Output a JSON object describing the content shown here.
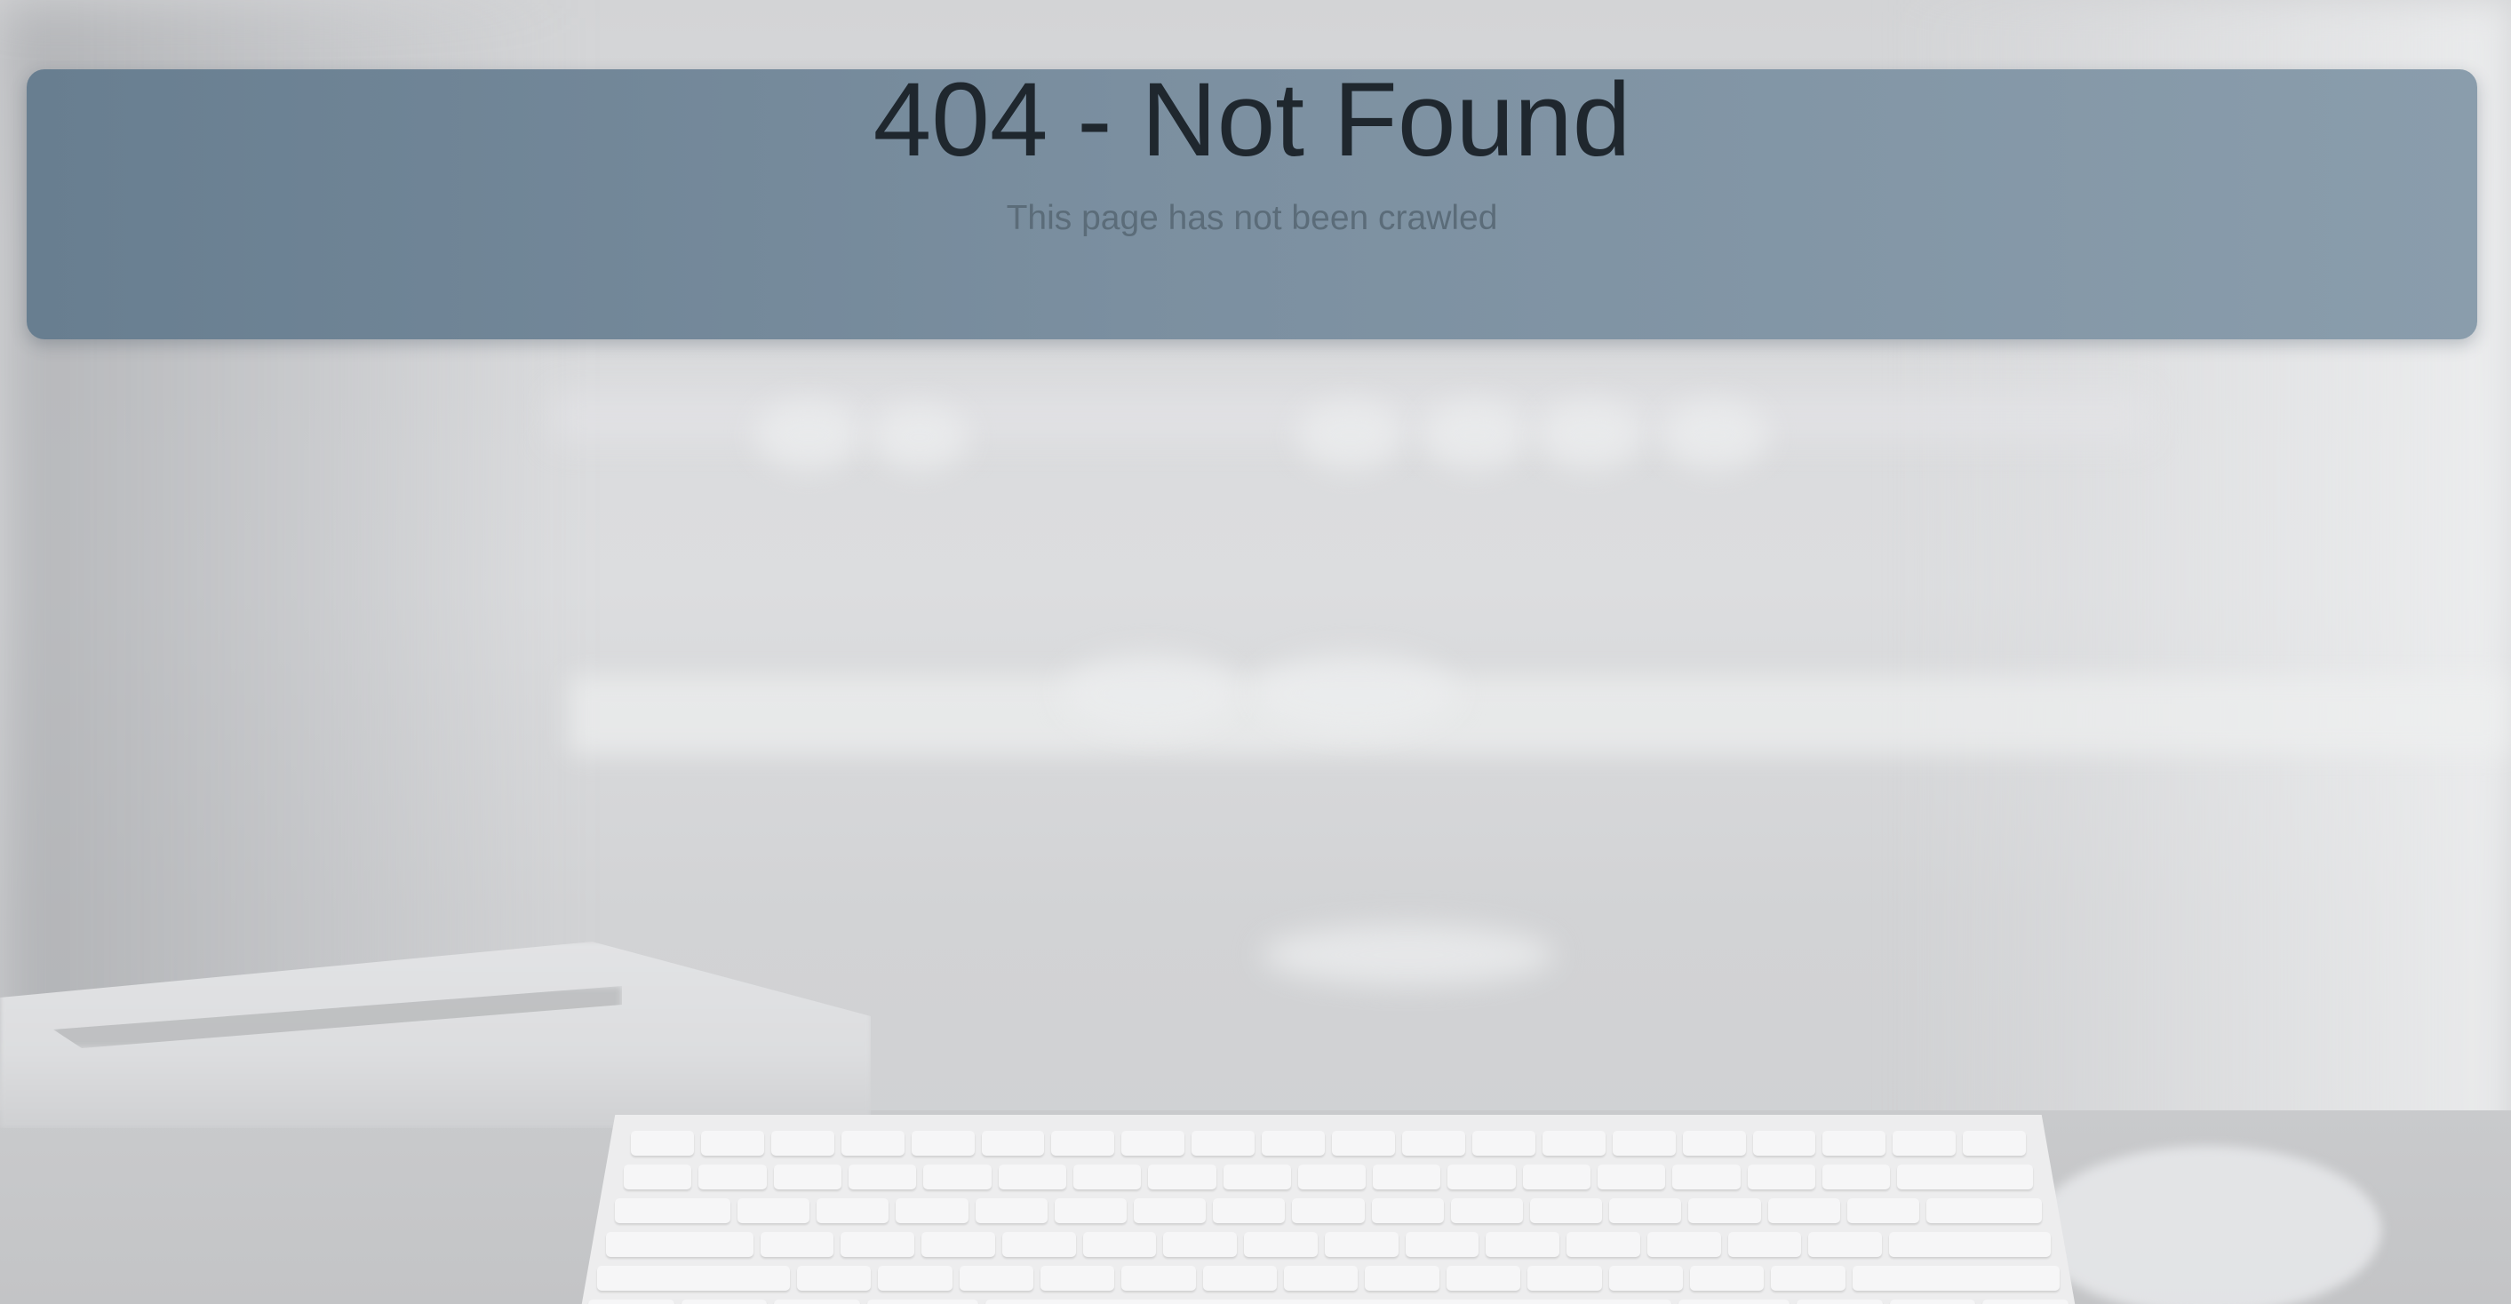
{
  "page": {
    "title": "404 - Not Found",
    "subtitle": "This page has not been crawled"
  },
  "background": {
    "scene": "blurred-desk-with-keyboard-laptop-mouse"
  },
  "colors": {
    "banner_start": "#687e90",
    "banner_end": "#8a9dac",
    "title_text": "#1f272e",
    "subtitle_text": "#5b6c79",
    "page_background": "#d9dadc"
  }
}
